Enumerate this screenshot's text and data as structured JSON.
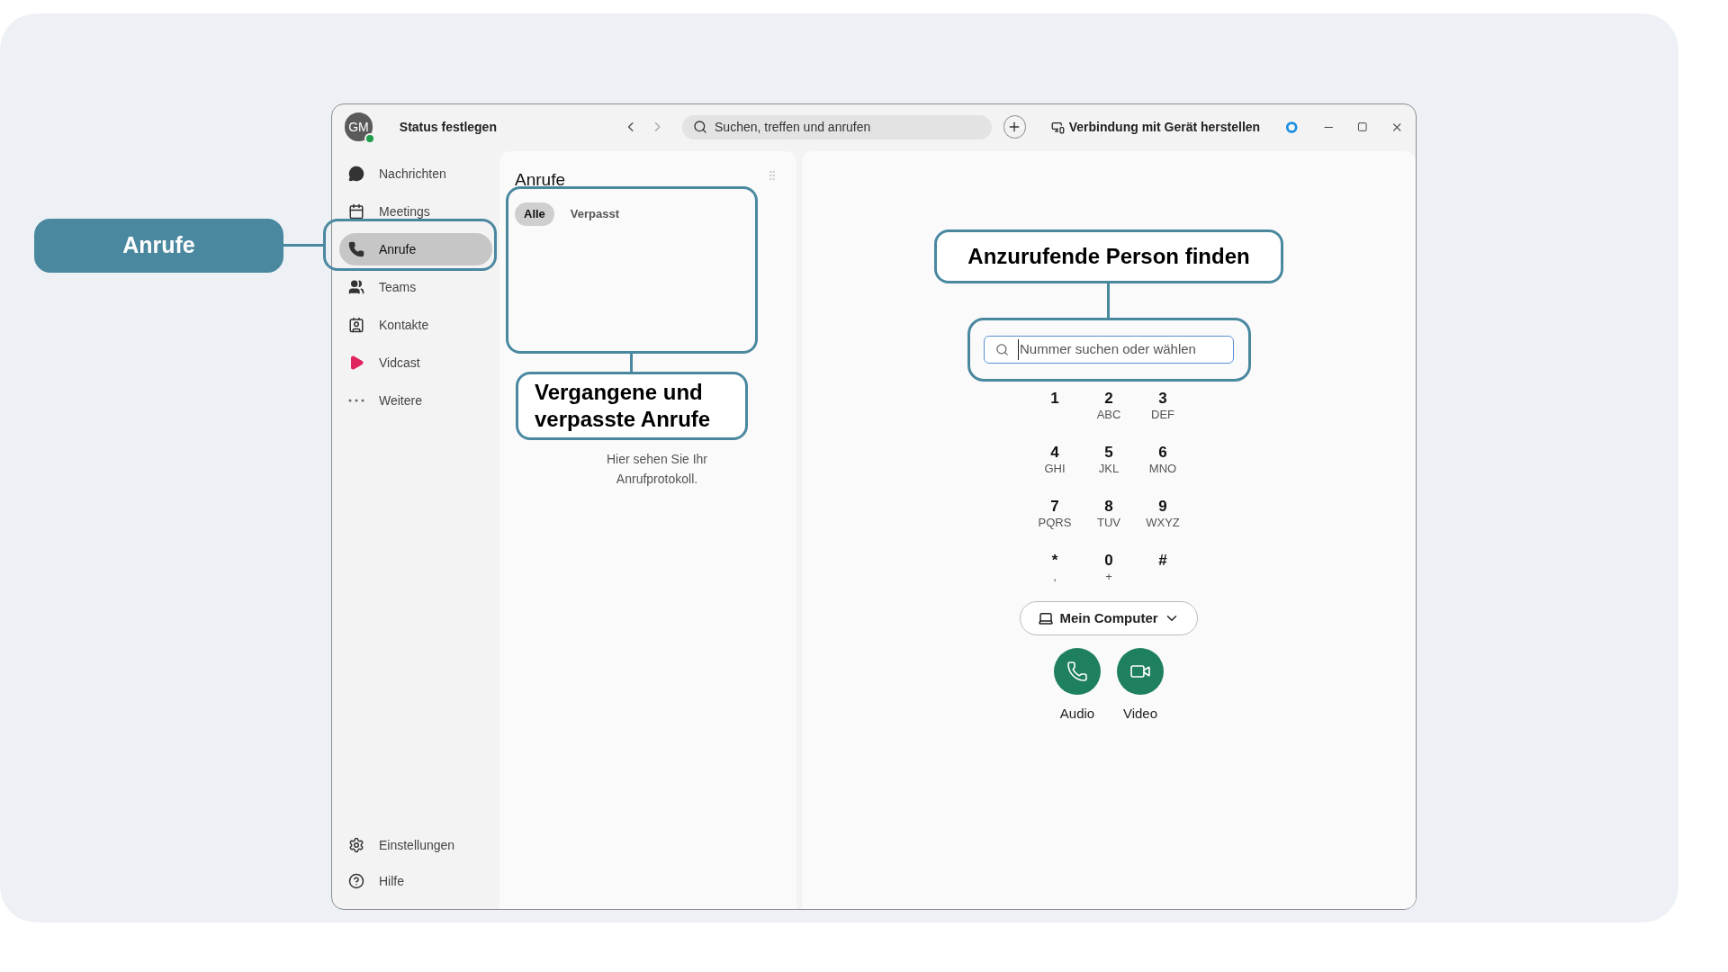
{
  "window": {
    "avatar_initials": "GM",
    "status": "Status festlegen",
    "search_placeholder": "Suchen, treffen und anrufen",
    "connect_device": "Verbindung mit Gerät herstellen"
  },
  "sidebar": {
    "items": [
      {
        "label": "Nachrichten",
        "selected": false
      },
      {
        "label": "Meetings",
        "selected": false
      },
      {
        "label": "Anrufe",
        "selected": true
      },
      {
        "label": "Teams",
        "selected": false
      },
      {
        "label": "Kontakte",
        "selected": false
      },
      {
        "label": "Vidcast",
        "selected": false
      },
      {
        "label": "Weitere",
        "selected": false
      }
    ],
    "footer_items": [
      {
        "label": "Einstellungen"
      },
      {
        "label": "Hilfe"
      }
    ]
  },
  "calls_panel": {
    "title": "Anrufe",
    "tabs": [
      {
        "label": "Alle",
        "selected": true
      },
      {
        "label": "Verpasst",
        "selected": false
      }
    ],
    "empty_message": "Hier sehen Sie Ihr Anrufprotokoll."
  },
  "dialer": {
    "placeholder": "Nummer suchen oder wählen",
    "keys": [
      {
        "digit": "1"
      },
      {
        "digit": "2",
        "letters": "ABC"
      },
      {
        "digit": "3",
        "letters": "DEF"
      },
      {
        "digit": "4",
        "letters": "GHI"
      },
      {
        "digit": "5",
        "letters": "JKL"
      },
      {
        "digit": "6",
        "letters": "MNO"
      },
      {
        "digit": "7",
        "letters": "PQRS"
      },
      {
        "digit": "8",
        "letters": "TUV"
      },
      {
        "digit": "9",
        "letters": "WXYZ"
      },
      {
        "digit": "*",
        "letters": ","
      },
      {
        "digit": "0",
        "letters": "+"
      },
      {
        "digit": "#"
      }
    ],
    "device_button": "Mein Computer",
    "actions": [
      {
        "label": "Audio"
      },
      {
        "label": "Video"
      }
    ]
  },
  "annotations": [
    {
      "text": "Anrufe",
      "kind": "filled"
    },
    {
      "text": "Vergangene und verpasste Anrufe",
      "kind": "outline"
    },
    {
      "text": "Anzurufende Person finden",
      "kind": "outline"
    }
  ]
}
